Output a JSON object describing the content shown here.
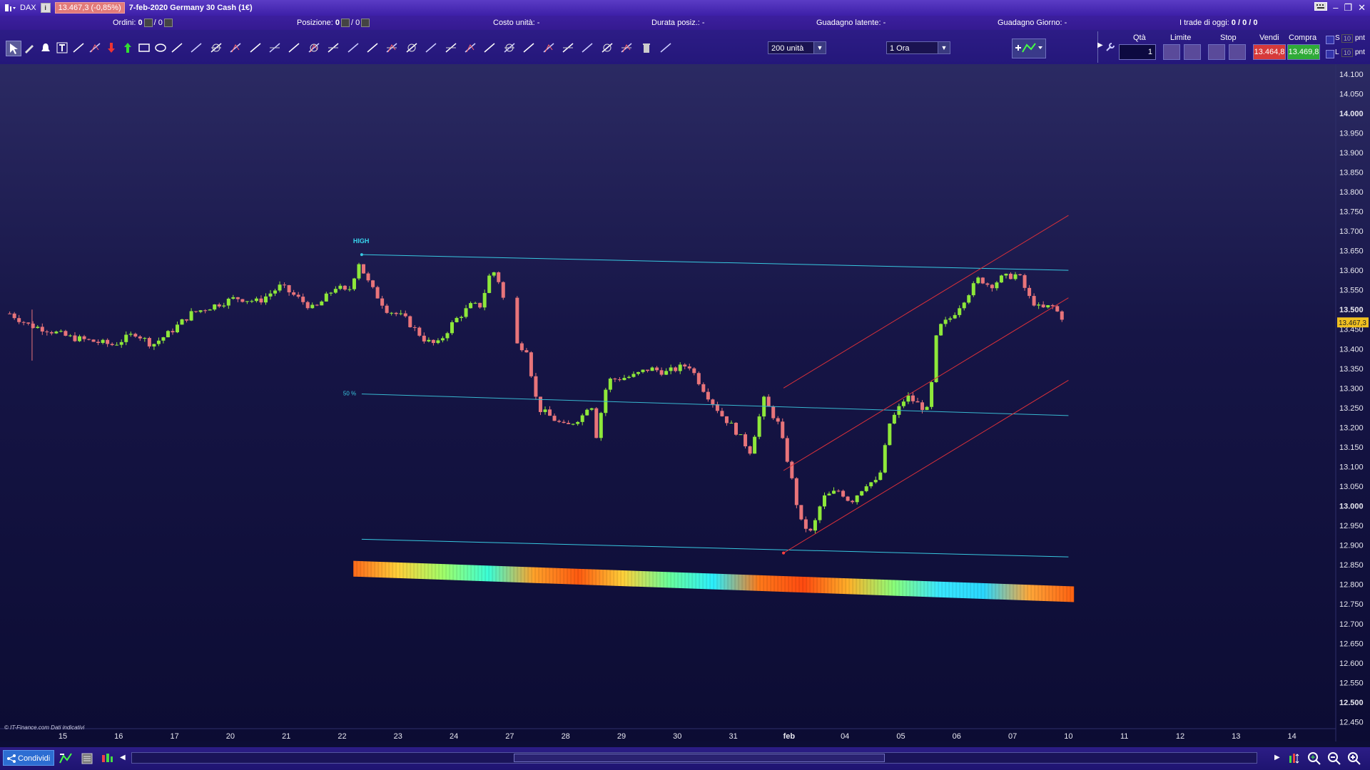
{
  "titlebar": {
    "symbol": "DAX",
    "price_badge": "13.467,3 (-0,85%)",
    "title": "7-feb-2020 Germany 30 Cash (1€)",
    "info": "i"
  },
  "statusbar": {
    "orders_label": "Ordini:",
    "orders_value": "0",
    "orders_sep": "/ 0",
    "position_label": "Posizione:",
    "position_value": "0",
    "position_sep": "/ 0",
    "unit_cost": "Costo unità: -",
    "duration": "Durata posiz.: -",
    "latent_gain": "Guadagno latente: -",
    "day_gain": "Guadagno Giorno: -",
    "trades_label": "I trade di oggi:",
    "trades_value": "0 / 0 / 0"
  },
  "toolbar": {
    "units_select": "200 unità",
    "timeframe_select": "1 Ora",
    "qty_label": "Qtà",
    "qty_value": "1",
    "limit_label": "Limite",
    "stop_label": "Stop",
    "sell_label": "Vendi",
    "buy_label": "Compra",
    "sell_price": "13.464,8",
    "buy_price": "13.469,8",
    "s_label": "S",
    "l_label": "L",
    "s_value": "10",
    "l_value": "10",
    "pnt": "pnt",
    "tools": [
      "pointer",
      "pencil",
      "alert",
      "text",
      "line-up",
      "zigzag",
      "arrow-down",
      "arrow-up",
      "rectangle",
      "ellipse",
      "circle-x",
      "triangle",
      "trendline",
      "horizontal-line",
      "vertical-line",
      "ray",
      "measure",
      "fib-time",
      "fib-fan",
      "fib-arc",
      "text-box",
      "wave",
      "pitchfork",
      "channel",
      "grid",
      "gann",
      "andrews",
      "spiral",
      "cycles",
      "regression",
      "levels",
      "parallel",
      "speed-lines",
      "raff",
      "trash",
      "arc"
    ]
  },
  "chart": {
    "annotation_high": "HIGH",
    "annotation_50": "50 %",
    "last_price_tag": "13.467,3",
    "copyright": "© IT-Finance.com  Dati indicativi"
  },
  "chart_data": {
    "type": "candlestick",
    "instrument": "Germany 30 Cash",
    "ylim": [
      12400,
      14125
    ],
    "y_ticks": [
      {
        "v": 14100,
        "t": "14.100",
        "b": false
      },
      {
        "v": 14050,
        "t": "14.050",
        "b": false
      },
      {
        "v": 14000,
        "t": "14.000",
        "b": true
      },
      {
        "v": 13950,
        "t": "13.950",
        "b": false
      },
      {
        "v": 13900,
        "t": "13.900",
        "b": false
      },
      {
        "v": 13850,
        "t": "13.850",
        "b": false
      },
      {
        "v": 13800,
        "t": "13.800",
        "b": false
      },
      {
        "v": 13750,
        "t": "13.750",
        "b": false
      },
      {
        "v": 13700,
        "t": "13.700",
        "b": false
      },
      {
        "v": 13650,
        "t": "13.650",
        "b": false
      },
      {
        "v": 13600,
        "t": "13.600",
        "b": false
      },
      {
        "v": 13550,
        "t": "13.550",
        "b": false
      },
      {
        "v": 13500,
        "t": "13.500",
        "b": true
      },
      {
        "v": 13450,
        "t": "13.450",
        "b": false
      },
      {
        "v": 13400,
        "t": "13.400",
        "b": false
      },
      {
        "v": 13350,
        "t": "13.350",
        "b": false
      },
      {
        "v": 13300,
        "t": "13.300",
        "b": false
      },
      {
        "v": 13250,
        "t": "13.250",
        "b": false
      },
      {
        "v": 13200,
        "t": "13.200",
        "b": false
      },
      {
        "v": 13150,
        "t": "13.150",
        "b": false
      },
      {
        "v": 13100,
        "t": "13.100",
        "b": false
      },
      {
        "v": 13050,
        "t": "13.050",
        "b": false
      },
      {
        "v": 13000,
        "t": "13.000",
        "b": true
      },
      {
        "v": 12950,
        "t": "12.950",
        "b": false
      },
      {
        "v": 12900,
        "t": "12.900",
        "b": false
      },
      {
        "v": 12850,
        "t": "12.850",
        "b": false
      },
      {
        "v": 12800,
        "t": "12.800",
        "b": false
      },
      {
        "v": 12750,
        "t": "12.750",
        "b": false
      },
      {
        "v": 12700,
        "t": "12.700",
        "b": false
      },
      {
        "v": 12650,
        "t": "12.650",
        "b": false
      },
      {
        "v": 12600,
        "t": "12.600",
        "b": false
      },
      {
        "v": 12550,
        "t": "12.550",
        "b": false
      },
      {
        "v": 12500,
        "t": "12.500",
        "b": true
      },
      {
        "v": 12450,
        "t": "12.450",
        "b": false
      }
    ],
    "x_ticks": [
      {
        "i": 0,
        "t": "15"
      },
      {
        "i": 1,
        "t": "16"
      },
      {
        "i": 2,
        "t": "17"
      },
      {
        "i": 3,
        "t": "20"
      },
      {
        "i": 4,
        "t": "21"
      },
      {
        "i": 5,
        "t": "22"
      },
      {
        "i": 6,
        "t": "23"
      },
      {
        "i": 7,
        "t": "24"
      },
      {
        "i": 8,
        "t": "27"
      },
      {
        "i": 9,
        "t": "28"
      },
      {
        "i": 10,
        "t": "29"
      },
      {
        "i": 11,
        "t": "30"
      },
      {
        "i": 12,
        "t": "31"
      },
      {
        "i": 13,
        "t": "feb",
        "b": true
      },
      {
        "i": 14,
        "t": "04"
      },
      {
        "i": 15,
        "t": "05"
      },
      {
        "i": 16,
        "t": "06"
      },
      {
        "i": 17,
        "t": "07"
      },
      {
        "i": 18,
        "t": "10"
      },
      {
        "i": 19,
        "t": "11"
      },
      {
        "i": 20,
        "t": "12"
      },
      {
        "i": 21,
        "t": "13"
      },
      {
        "i": 22,
        "t": "14"
      }
    ],
    "close_path": [
      {
        "d": -0.95,
        "p": 13490
      },
      {
        "d": -0.6,
        "p": 13460
      },
      {
        "d": -0.3,
        "p": 13450
      },
      {
        "d": 0.1,
        "p": 13430
      },
      {
        "d": 0.5,
        "p": 13420
      },
      {
        "d": 0.9,
        "p": 13410
      },
      {
        "d": 1.3,
        "p": 13440
      },
      {
        "d": 1.6,
        "p": 13410
      },
      {
        "d": 1.9,
        "p": 13440
      },
      {
        "d": 2.3,
        "p": 13490
      },
      {
        "d": 2.7,
        "p": 13510
      },
      {
        "d": 3.1,
        "p": 13530
      },
      {
        "d": 3.5,
        "p": 13520
      },
      {
        "d": 3.9,
        "p": 13560
      },
      {
        "d": 4.2,
        "p": 13530
      },
      {
        "d": 4.5,
        "p": 13500
      },
      {
        "d": 4.9,
        "p": 13560
      },
      {
        "d": 5.1,
        "p": 13540
      },
      {
        "d": 5.3,
        "p": 13620
      },
      {
        "d": 5.5,
        "p": 13560
      },
      {
        "d": 5.8,
        "p": 13500
      },
      {
        "d": 6.1,
        "p": 13480
      },
      {
        "d": 6.5,
        "p": 13420
      },
      {
        "d": 6.7,
        "p": 13410
      },
      {
        "d": 7.0,
        "p": 13470
      },
      {
        "d": 7.3,
        "p": 13510
      },
      {
        "d": 7.5,
        "p": 13510
      },
      {
        "d": 7.6,
        "p": 13580
      },
      {
        "d": 7.75,
        "p": 13600
      },
      {
        "d": 7.9,
        "p": 13520
      },
      {
        "d": 8.0,
        "p": 13420
      },
      {
        "d": 8.3,
        "p": 13400
      },
      {
        "d": 8.5,
        "p": 13250
      },
      {
        "d": 8.8,
        "p": 13220
      },
      {
        "d": 9.0,
        "p": 13200
      },
      {
        "d": 9.3,
        "p": 13230
      },
      {
        "d": 9.45,
        "p": 13270
      },
      {
        "d": 9.55,
        "p": 13180
      },
      {
        "d": 9.75,
        "p": 13320
      },
      {
        "d": 10.2,
        "p": 13330
      },
      {
        "d": 10.5,
        "p": 13350
      },
      {
        "d": 10.8,
        "p": 13340
      },
      {
        "d": 11.2,
        "p": 13360
      },
      {
        "d": 11.5,
        "p": 13290
      },
      {
        "d": 11.8,
        "p": 13230
      },
      {
        "d": 12.0,
        "p": 13200
      },
      {
        "d": 12.3,
        "p": 13140
      },
      {
        "d": 12.55,
        "p": 13270
      },
      {
        "d": 12.8,
        "p": 13210
      },
      {
        "d": 13.0,
        "p": 13100
      },
      {
        "d": 13.2,
        "p": 12960
      },
      {
        "d": 13.4,
        "p": 12930
      },
      {
        "d": 13.6,
        "p": 13020
      },
      {
        "d": 13.9,
        "p": 13040
      },
      {
        "d": 14.1,
        "p": 13010
      },
      {
        "d": 14.4,
        "p": 13060
      },
      {
        "d": 14.6,
        "p": 13060
      },
      {
        "d": 14.8,
        "p": 13210
      },
      {
        "d": 15.1,
        "p": 13280
      },
      {
        "d": 15.3,
        "p": 13260
      },
      {
        "d": 15.5,
        "p": 13240
      },
      {
        "d": 15.65,
        "p": 13450
      },
      {
        "d": 15.9,
        "p": 13480
      },
      {
        "d": 16.2,
        "p": 13540
      },
      {
        "d": 16.4,
        "p": 13580
      },
      {
        "d": 16.6,
        "p": 13560
      },
      {
        "d": 16.8,
        "p": 13580
      },
      {
        "d": 17.1,
        "p": 13590
      },
      {
        "d": 17.3,
        "p": 13530
      },
      {
        "d": 17.5,
        "p": 13500
      },
      {
        "d": 17.7,
        "p": 13510
      },
      {
        "d": 17.95,
        "p": 13470
      }
    ],
    "gap_start_day": 7.95,
    "gap_end_day": 8.05,
    "candles_per_day": 12,
    "volatility": 9,
    "high_line": {
      "from": [
        5.35,
        13640
      ],
      "to": [
        18.0,
        13600
      ]
    },
    "fifty_line": {
      "from": [
        5.35,
        13285
      ],
      "to": [
        18.0,
        13230
      ]
    },
    "low_line": {
      "from": [
        5.35,
        12915
      ],
      "to": [
        18.0,
        12870
      ]
    },
    "channel": [
      {
        "from": [
          12.9,
          13300
        ],
        "to": [
          18.0,
          13740
        ]
      },
      {
        "from": [
          12.9,
          13090
        ],
        "to": [
          18.0,
          13530
        ]
      },
      {
        "from": [
          12.9,
          12880
        ],
        "to": [
          18.0,
          13320
        ]
      }
    ],
    "low_point": [
      12.9,
      12880
    ],
    "high_point": [
      5.35,
      13640
    ],
    "last_price": 13467.3,
    "heatmap_band": {
      "from_day": 5.2,
      "to_day": 18.1,
      "top_start": 12860,
      "top_end": 12795,
      "thickness": 40
    }
  },
  "bottom": {
    "share_label": "Condividi"
  }
}
